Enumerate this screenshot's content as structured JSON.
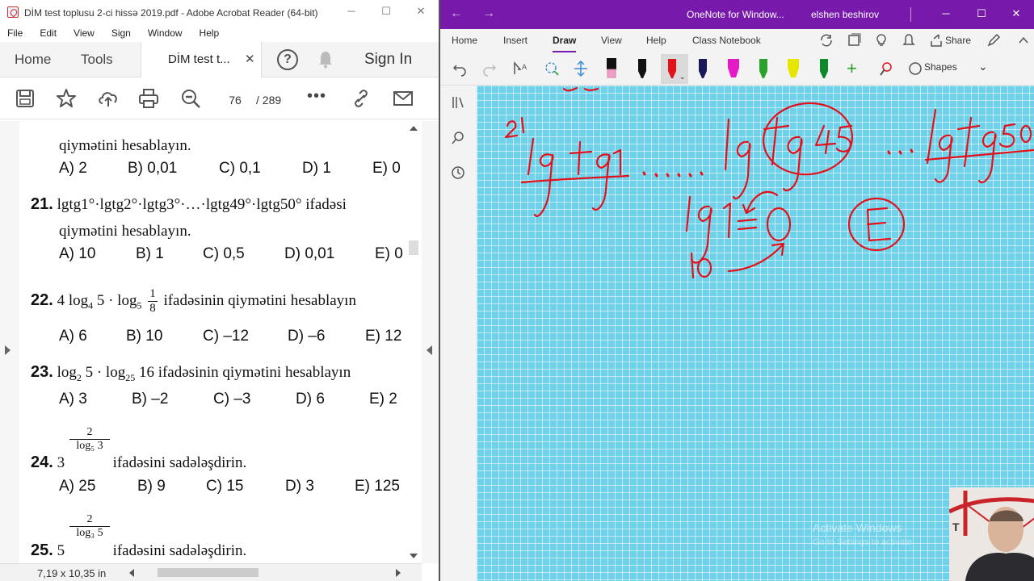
{
  "acrobat": {
    "title": "DİM test toplusu 2-ci hissə 2019.pdf - Adobe Acrobat Reader (64-bit)",
    "menu": [
      "File",
      "Edit",
      "View",
      "Sign",
      "Window",
      "Help"
    ],
    "tab_home": "Home",
    "tab_tools": "Tools",
    "tab_doc": "DİM test t...",
    "sign_in": "Sign In",
    "page_current": "76",
    "page_total": "/  289",
    "page_size": "7,19 x 10,35 in"
  },
  "doc": {
    "q20_line2": "qiymətini hesablayın.",
    "q20_opts": [
      "A) 2",
      "B) 0,01",
      "C) 0,1",
      "D) 1",
      "E) 0"
    ],
    "q21_num": "21.",
    "q21_text": "lgtg1°·lgtg2°·lgtg3°·…·lgtg49°·lgtg50°  ifadəsi",
    "q21_line2": "qiymətini hesablayın.",
    "q21_opts": [
      "A) 10",
      "B) 1",
      "C) 0,5",
      "D) 0,01",
      "E) 0"
    ],
    "q22_num": "22.",
    "q22_a": "4 log",
    "q22_sub1": "4",
    "q22_b": " 5 · log",
    "q22_sub2": "5",
    "q22_fn": "1",
    "q22_fd": "8",
    "q22_c": "ifadəsinin qiymətini hesablayın",
    "q22_opts": [
      "A) 6",
      "B) 10",
      "C) –12",
      "D) –6",
      "E) 12"
    ],
    "q23_num": "23.",
    "q23_a": "log",
    "q23_sub1": "2",
    "q23_b": " 5 · log",
    "q23_sub2": "25",
    "q23_c": " 16  ifadəsinin qiymətini hesablayın",
    "q23_opts": [
      "A) 3",
      "B) –2",
      "C) –3",
      "D) 6",
      "E) 2"
    ],
    "q24_num": "24.",
    "q24_base": "3",
    "q24_en": "2",
    "q24_ed": "log₅ 3",
    "q24_text": "ifadəsini sadələşdirin.",
    "q24_opts": [
      "A) 25",
      "B) 9",
      "C) 15",
      "D) 3",
      "E) 125"
    ],
    "q25_num": "25.",
    "q25_base": "5",
    "q25_en": "2",
    "q25_ed": "log₃ 5",
    "q25_text": "ifadəsini sadələşdirin."
  },
  "onenote": {
    "title": "OneNote for Window...",
    "user": "elshen beshirov",
    "tabs": [
      "Home",
      "Insert",
      "Draw",
      "View",
      "Help",
      "Class Notebook"
    ],
    "share": "Share",
    "shapes": "Shapes",
    "pen_colors": [
      "#111111",
      "#111111",
      "#e4111b",
      "#1a1a5a",
      "#e619c8",
      "#2ca02c",
      "#e6e600",
      "#0c8a2a"
    ],
    "canvas_color": "#6fd1ea",
    "watermark": "Activate Windows",
    "watermark2": "Go to Settings to activate"
  }
}
